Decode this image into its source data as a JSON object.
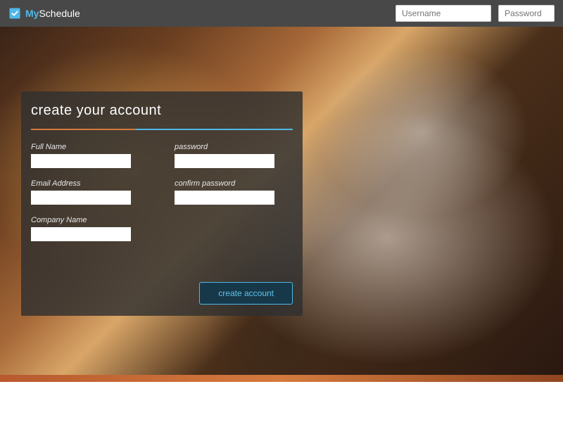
{
  "brand": {
    "prefix": "My",
    "suffix": "Schedule"
  },
  "topbar": {
    "username_placeholder": "Username",
    "password_placeholder": "Password"
  },
  "card": {
    "title": "create your account",
    "fields": {
      "fullname_label": "Full Name",
      "email_label": "Email Address",
      "company_label": "Company Name",
      "password_label": "password",
      "confirm_label": "confirm password"
    },
    "submit_label": "create account"
  }
}
